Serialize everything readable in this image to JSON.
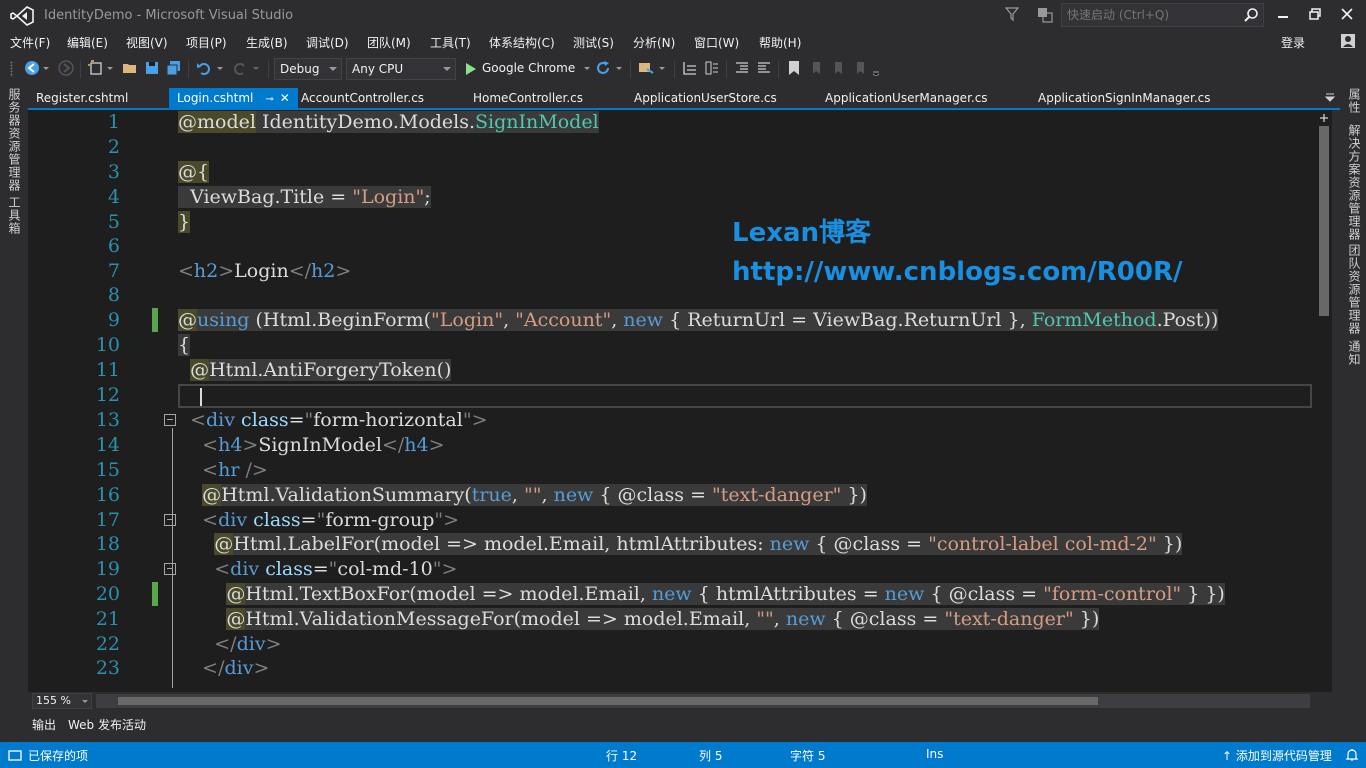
{
  "window": {
    "title": "IdentityDemo - Microsoft Visual Studio",
    "quick_launch_placeholder": "快速启动 (Ctrl+Q)",
    "login_label": "登录"
  },
  "menu": [
    "文件(F)",
    "编辑(E)",
    "视图(V)",
    "项目(P)",
    "生成(B)",
    "调试(D)",
    "团队(M)",
    "工具(T)",
    "体系结构(C)",
    "测试(S)",
    "分析(N)",
    "窗口(W)",
    "帮助(H)"
  ],
  "toolbar": {
    "configuration": "Debug",
    "platform": "Any CPU",
    "run_target": "Google Chrome"
  },
  "left_tool_windows": [
    "服务器资源管理器",
    "工具箱"
  ],
  "right_tool_windows": [
    "属性",
    "解决方案资源管理器",
    "团队资源管理器",
    "通知"
  ],
  "doc_tabs": [
    {
      "label": "Register.cshtml",
      "active": false
    },
    {
      "label": "Login.cshtml",
      "active": true
    },
    {
      "label": "AccountController.cs",
      "active": false
    },
    {
      "label": "HomeController.cs",
      "active": false
    },
    {
      "label": "ApplicationUserStore.cs",
      "active": false
    },
    {
      "label": "ApplicationUserManager.cs",
      "active": false
    },
    {
      "label": "ApplicationSignInManager.cs",
      "active": false
    }
  ],
  "line_numbers": [
    "1",
    "2",
    "3",
    "4",
    "5",
    "6",
    "7",
    "8",
    "9",
    "10",
    "11",
    "12",
    "13",
    "14",
    "15",
    "16",
    "17",
    "18",
    "19",
    "20",
    "21",
    "22",
    "23"
  ],
  "watermark": {
    "line1": "Lexan博客",
    "line2": "http://www.cnblogs.com/R00R/"
  },
  "zoom": "155 %",
  "output_tabs": [
    "输出",
    "Web 发布活动"
  ],
  "status": {
    "message": "已保存的项",
    "row": "行 12",
    "col": "列 5",
    "char": "字符 5",
    "mode": "Ins",
    "source_control": "添加到源代码管理"
  },
  "colors": {
    "accent": "#007acc",
    "editor_bg": "#1e1e1e",
    "keyword": "#569cd6",
    "string": "#d69d85",
    "type": "#4ec9b0",
    "line_number": "#2b91af",
    "watermark": "#1a8fe0"
  }
}
